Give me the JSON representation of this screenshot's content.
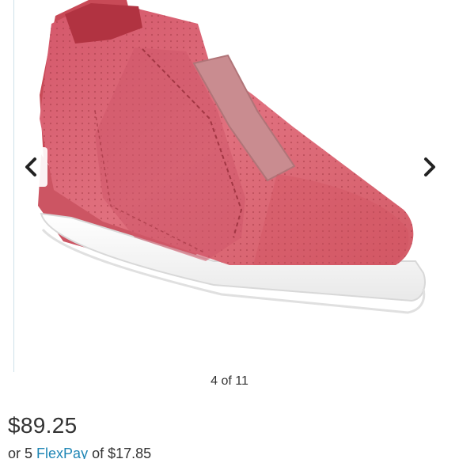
{
  "carousel": {
    "counter": "4 of 11",
    "prev_icon": "chevron-left-icon",
    "next_icon": "chevron-right-icon",
    "image_subject": "pink perforated wedge sneaker with elastic strap",
    "colors": {
      "shoe_main": "#d9606d",
      "shoe_shadow": "#b9454f",
      "elastic_band": "#c98c90",
      "sole": "#ffffff",
      "chevron": "#222222"
    }
  },
  "product": {
    "price": "$89.25",
    "installment_prefix": "or 5",
    "installment_link": "FlexPay",
    "installment_suffix": "of $17.85",
    "link_color": "#1f86b5"
  }
}
